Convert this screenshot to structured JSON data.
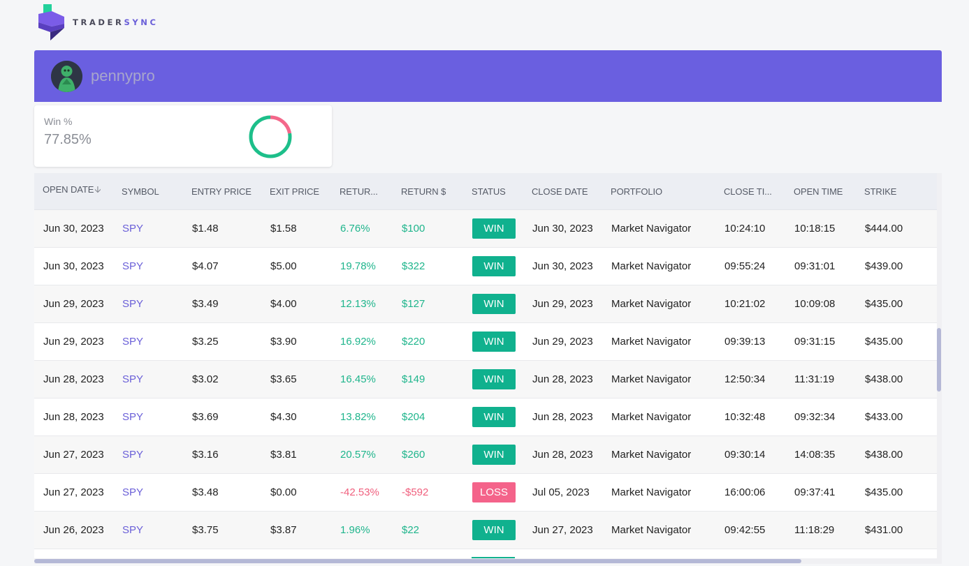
{
  "brand": {
    "name_a": "TRADER",
    "name_b": "SYNC"
  },
  "profile": {
    "username": "pennypro"
  },
  "stats": {
    "win_label": "Win %",
    "win_value": "77.85%",
    "win_fraction": 0.7785,
    "win_color": "#1dbf8a",
    "loss_color": "#f4678a"
  },
  "table": {
    "headers": [
      "OPEN DATE",
      "SYMBOL",
      "ENTRY PRICE",
      "EXIT PRICE",
      "RETUR...",
      "RETURN $",
      "STATUS",
      "CLOSE DATE",
      "PORTFOLIO",
      "CLOSE TI...",
      "OPEN TIME",
      "STRIKE"
    ],
    "sort_icon": "arrow-down-icon",
    "rows": [
      {
        "open_date": "Jun 30, 2023",
        "symbol": "SPY",
        "entry": "$1.48",
        "exit": "$1.58",
        "ret_pct": "6.76%",
        "ret_usd": "$100",
        "status": "WIN",
        "close_date": "Jun 30, 2023",
        "portfolio": "Market Navigator",
        "close_time": "10:24:10",
        "open_time": "10:18:15",
        "strike": "$444.00"
      },
      {
        "open_date": "Jun 30, 2023",
        "symbol": "SPY",
        "entry": "$4.07",
        "exit": "$5.00",
        "ret_pct": "19.78%",
        "ret_usd": "$322",
        "status": "WIN",
        "close_date": "Jun 30, 2023",
        "portfolio": "Market Navigator",
        "close_time": "09:55:24",
        "open_time": "09:31:01",
        "strike": "$439.00"
      },
      {
        "open_date": "Jun 29, 2023",
        "symbol": "SPY",
        "entry": "$3.49",
        "exit": "$4.00",
        "ret_pct": "12.13%",
        "ret_usd": "$127",
        "status": "WIN",
        "close_date": "Jun 29, 2023",
        "portfolio": "Market Navigator",
        "close_time": "10:21:02",
        "open_time": "10:09:08",
        "strike": "$435.00"
      },
      {
        "open_date": "Jun 29, 2023",
        "symbol": "SPY",
        "entry": "$3.25",
        "exit": "$3.90",
        "ret_pct": "16.92%",
        "ret_usd": "$220",
        "status": "WIN",
        "close_date": "Jun 29, 2023",
        "portfolio": "Market Navigator",
        "close_time": "09:39:13",
        "open_time": "09:31:15",
        "strike": "$435.00"
      },
      {
        "open_date": "Jun 28, 2023",
        "symbol": "SPY",
        "entry": "$3.02",
        "exit": "$3.65",
        "ret_pct": "16.45%",
        "ret_usd": "$149",
        "status": "WIN",
        "close_date": "Jun 28, 2023",
        "portfolio": "Market Navigator",
        "close_time": "12:50:34",
        "open_time": "11:31:19",
        "strike": "$438.00"
      },
      {
        "open_date": "Jun 28, 2023",
        "symbol": "SPY",
        "entry": "$3.69",
        "exit": "$4.30",
        "ret_pct": "13.82%",
        "ret_usd": "$204",
        "status": "WIN",
        "close_date": "Jun 28, 2023",
        "portfolio": "Market Navigator",
        "close_time": "10:32:48",
        "open_time": "09:32:34",
        "strike": "$433.00"
      },
      {
        "open_date": "Jun 27, 2023",
        "symbol": "SPY",
        "entry": "$3.16",
        "exit": "$3.81",
        "ret_pct": "20.57%",
        "ret_usd": "$260",
        "status": "WIN",
        "close_date": "Jun 28, 2023",
        "portfolio": "Market Navigator",
        "close_time": "09:30:14",
        "open_time": "14:08:35",
        "strike": "$438.00"
      },
      {
        "open_date": "Jun 27, 2023",
        "symbol": "SPY",
        "entry": "$3.48",
        "exit": "$0.00",
        "ret_pct": "-42.53%",
        "ret_usd": "-$592",
        "status": "LOSS",
        "close_date": "Jul 05, 2023",
        "portfolio": "Market Navigator",
        "close_time": "16:00:06",
        "open_time": "09:37:41",
        "strike": "$435.00"
      },
      {
        "open_date": "Jun 26, 2023",
        "symbol": "SPY",
        "entry": "$3.75",
        "exit": "$3.87",
        "ret_pct": "1.96%",
        "ret_usd": "$22",
        "status": "WIN",
        "close_date": "Jun 27, 2023",
        "portfolio": "Market Navigator",
        "close_time": "09:42:55",
        "open_time": "11:18:29",
        "strike": "$431.00"
      }
    ]
  }
}
